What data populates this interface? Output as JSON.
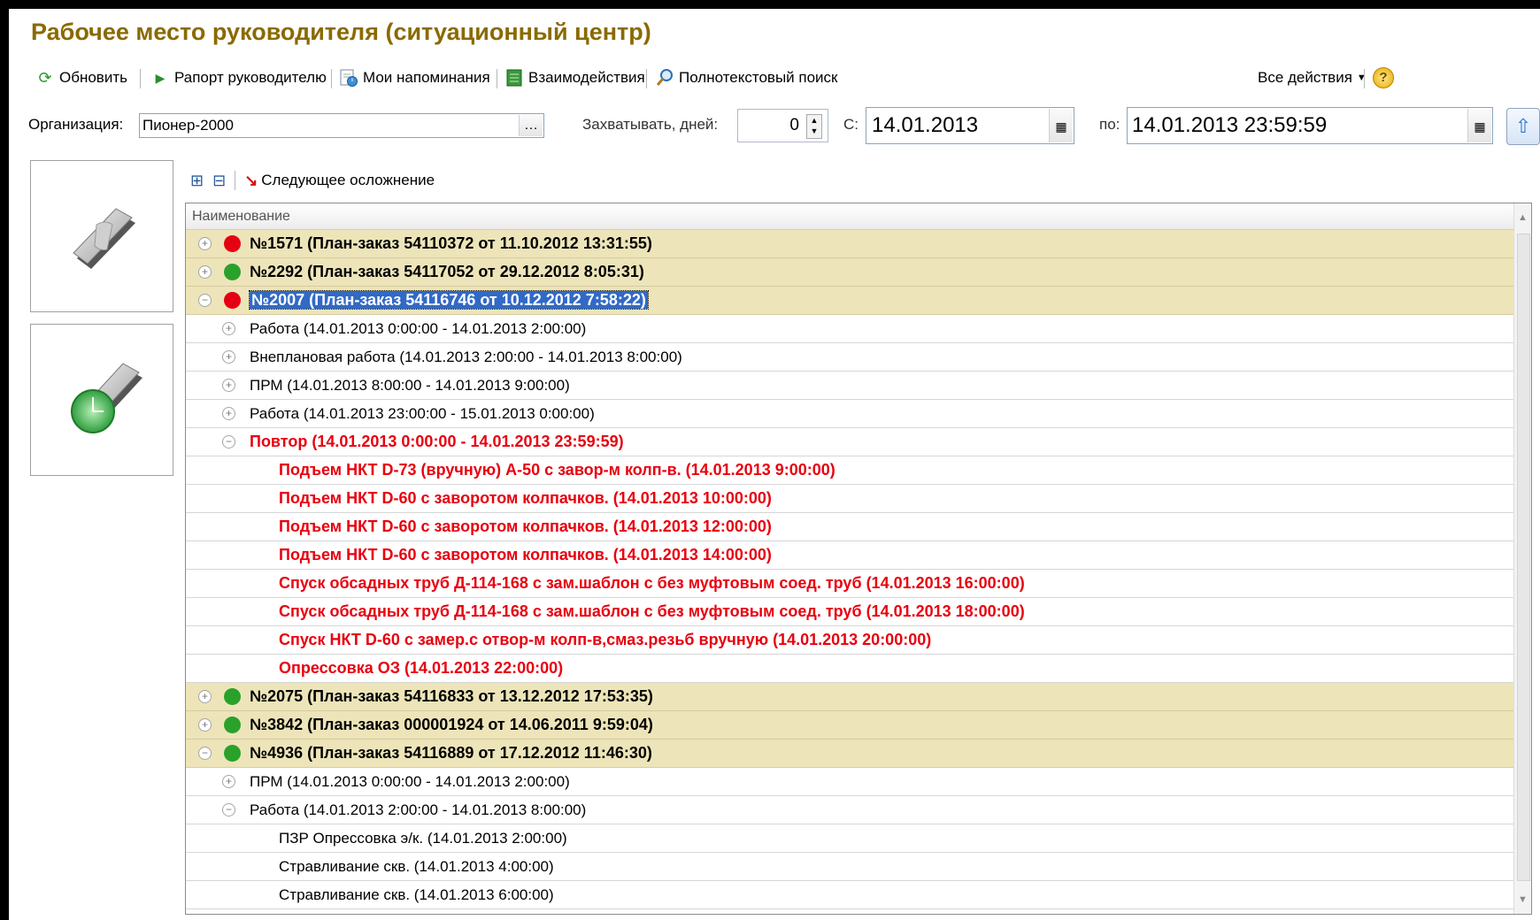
{
  "window": {
    "title": "Рабочее место руководителя (ситуационный центр)"
  },
  "toolbar": {
    "refresh": "Обновить",
    "report": "Рапорт руководителю",
    "reminders": "Мои напоминания",
    "interactions": "Взаимодействия",
    "fulltext": "Полнотекстовый поиск",
    "all_actions": "Все действия",
    "help_icon": "?"
  },
  "filter": {
    "org_label": "Организация:",
    "org_value": "Пионер-2000",
    "capture_label": "Захватывать, дней:",
    "capture_value": "0",
    "from_label": "С:",
    "from_value": "14.01.2013",
    "to_label": "по:",
    "to_value": "14.01.2013 23:59:59"
  },
  "subtoolbar": {
    "next": "Следующее осложнение"
  },
  "tree": {
    "column": "Наименование",
    "rows": [
      {
        "level": 0,
        "expander": "+",
        "status": "red",
        "text": "№1571 (План-заказ 54110372 от 11.10.2012 13:31:55)"
      },
      {
        "level": 0,
        "expander": "+",
        "status": "green",
        "text": "№2292 (План-заказ 54117052 от 29.12.2012 8:05:31)"
      },
      {
        "level": 0,
        "expander": "−",
        "status": "red",
        "text": "№2007 (План-заказ 54116746 от 10.12.2012 7:58:22)",
        "selected": true
      },
      {
        "level": 1,
        "expander": "+",
        "text": "Работа (14.01.2013 0:00:00 - 14.01.2013 2:00:00)"
      },
      {
        "level": 1,
        "expander": "+",
        "text": "Внеплановая работа (14.01.2013 2:00:00 - 14.01.2013 8:00:00)"
      },
      {
        "level": 1,
        "expander": "+",
        "text": "ПРМ (14.01.2013 8:00:00 - 14.01.2013 9:00:00)"
      },
      {
        "level": 1,
        "expander": "+",
        "text": "Работа (14.01.2013 23:00:00 - 15.01.2013 0:00:00)"
      },
      {
        "level": 1,
        "expander": "−",
        "red": true,
        "text": "Повтор (14.01.2013 0:00:00 - 14.01.2013 23:59:59)"
      },
      {
        "level": 2,
        "red": true,
        "text": "Подъем НКТ D-73  (вручную) А-50 с завор-м колп-в. (14.01.2013 9:00:00)"
      },
      {
        "level": 2,
        "red": true,
        "text": "Подъем НКТ D-60 с заворотом колпачков. (14.01.2013 10:00:00)"
      },
      {
        "level": 2,
        "red": true,
        "text": "Подъем НКТ D-60 с заворотом колпачков. (14.01.2013 12:00:00)"
      },
      {
        "level": 2,
        "red": true,
        "text": "Подъем НКТ D-60 с заворотом колпачков. (14.01.2013 14:00:00)"
      },
      {
        "level": 2,
        "red": true,
        "text": "Спуск обсадных труб Д-114-168 с зам.шаблон  с без муфтовым  соед. труб (14.01.2013 16:00:00)"
      },
      {
        "level": 2,
        "red": true,
        "text": "Спуск обсадных труб Д-114-168 с зам.шаблон  с без муфтовым  соед. труб (14.01.2013 18:00:00)"
      },
      {
        "level": 2,
        "red": true,
        "text": "Спуск НКТ D-60 с замер.с отвор-м колп-в,смаз.резьб вручную (14.01.2013 20:00:00)"
      },
      {
        "level": 2,
        "red": true,
        "text": "Опрессовка ОЗ (14.01.2013 22:00:00)"
      },
      {
        "level": 0,
        "expander": "+",
        "status": "green",
        "text": "№2075 (План-заказ 54116833 от 13.12.2012 17:53:35)"
      },
      {
        "level": 0,
        "expander": "+",
        "status": "green",
        "text": "№3842 (План-заказ 000001924 от 14.06.2011 9:59:04)"
      },
      {
        "level": 0,
        "expander": "−",
        "status": "green",
        "text": "№4936 (План-заказ 54116889 от 17.12.2012 11:46:30)"
      },
      {
        "level": 1,
        "expander": "+",
        "text": "ПРМ (14.01.2013 0:00:00 - 14.01.2013 2:00:00)"
      },
      {
        "level": 1,
        "expander": "−",
        "text": "Работа (14.01.2013 2:00:00 - 14.01.2013 8:00:00)"
      },
      {
        "level": 2,
        "text": "ПЗР Опрессовка  э/к. (14.01.2013 2:00:00)"
      },
      {
        "level": 2,
        "text": "Стравливание скв. (14.01.2013 4:00:00)"
      },
      {
        "level": 2,
        "text": "Стравливание скв. (14.01.2013 6:00:00)"
      }
    ]
  },
  "colors": {
    "title": "#8a6a00",
    "group_bg": "#ede5b9",
    "status_red": "#e60012",
    "status_green": "#2aa12a",
    "alert_text": "#e8000f",
    "selection": "#3169c6"
  }
}
